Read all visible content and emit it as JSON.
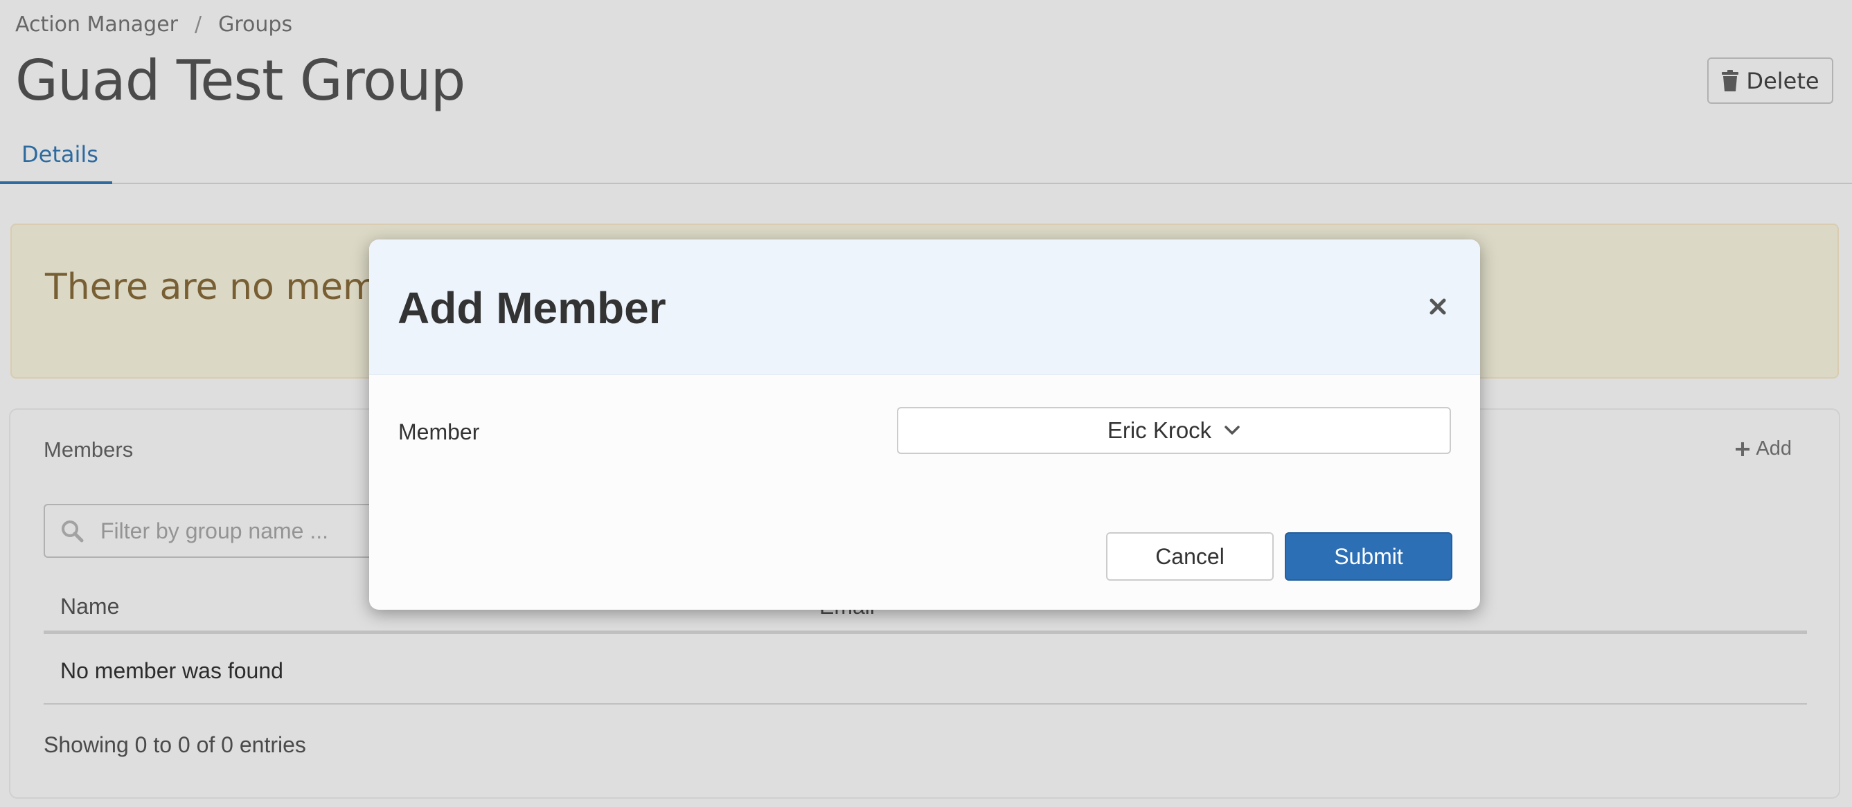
{
  "breadcrumb": {
    "items": [
      "Action Manager",
      "Groups"
    ],
    "separator": "/"
  },
  "page": {
    "title": "Guad Test Group",
    "delete_label": "Delete"
  },
  "tabs": [
    {
      "label": "Details",
      "active": true
    }
  ],
  "alert": {
    "text": "There are no members in this group"
  },
  "members_panel": {
    "title": "Members",
    "add_label": "Add",
    "filter_placeholder": "Filter by group name ...",
    "columns": [
      "Name",
      "Email"
    ],
    "empty_row": "No member was found",
    "entries_info": "Showing 0 to 0 of 0 entries"
  },
  "modal": {
    "title": "Add Member",
    "field_label": "Member",
    "selected_member": "Eric Krock",
    "cancel_label": "Cancel",
    "submit_label": "Submit"
  },
  "colors": {
    "accent": "#337ab7",
    "submit": "#2c6fb5",
    "alert_text": "#8a6d3b",
    "alert_bg": "#fcf8e3",
    "modal_header_bg": "#eef4fc"
  },
  "icons": {
    "delete": "trash-icon",
    "add": "plus-icon",
    "filter": "search-icon",
    "close": "close-icon",
    "select": "chevron-down-icon"
  }
}
